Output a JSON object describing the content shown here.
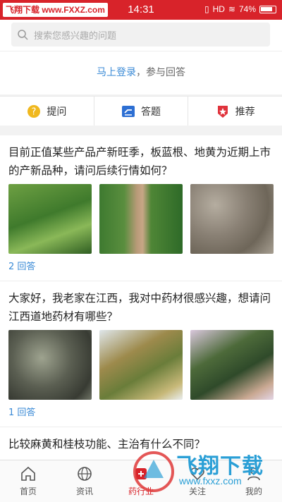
{
  "status": {
    "watermark": "飞翔下载 www.FXXZ.com",
    "time": "14:31",
    "hd": "HD",
    "battery": "74%"
  },
  "search": {
    "placeholder": "搜索您感兴趣的问题"
  },
  "login": {
    "link": "马上登录",
    "rest": "，参与回答"
  },
  "actions": [
    {
      "label": "提问",
      "icon": "question-icon"
    },
    {
      "label": "答题",
      "icon": "answer-icon"
    },
    {
      "label": "推荐",
      "icon": "recommend-icon"
    }
  ],
  "posts": [
    {
      "title": "目前正值某些产品产新旺季，板蓝根、地黄为近期上市的产新品种，请问后续行情如何？",
      "answers": "2 回答"
    },
    {
      "title": "大家好，我老家在江西，我对中药材很感兴趣，想请问江西道地药材有哪些？",
      "answers": "1 回答"
    },
    {
      "title": "比较麻黄和桂枝功能、主治有什么不同？"
    }
  ],
  "tabs": [
    {
      "label": "首页",
      "icon": "home-icon"
    },
    {
      "label": "资讯",
      "icon": "globe-icon"
    },
    {
      "label": "药行业",
      "icon": "pharma-icon"
    },
    {
      "label": "关注",
      "icon": "follow-icon"
    },
    {
      "label": "我的",
      "icon": "user-icon"
    }
  ],
  "watermark_overlay": {
    "brand": "飞翔下载",
    "url": "www.fxxz.com"
  },
  "colors": {
    "brand_red": "#d8232a",
    "link_blue": "#3a8ad6"
  }
}
